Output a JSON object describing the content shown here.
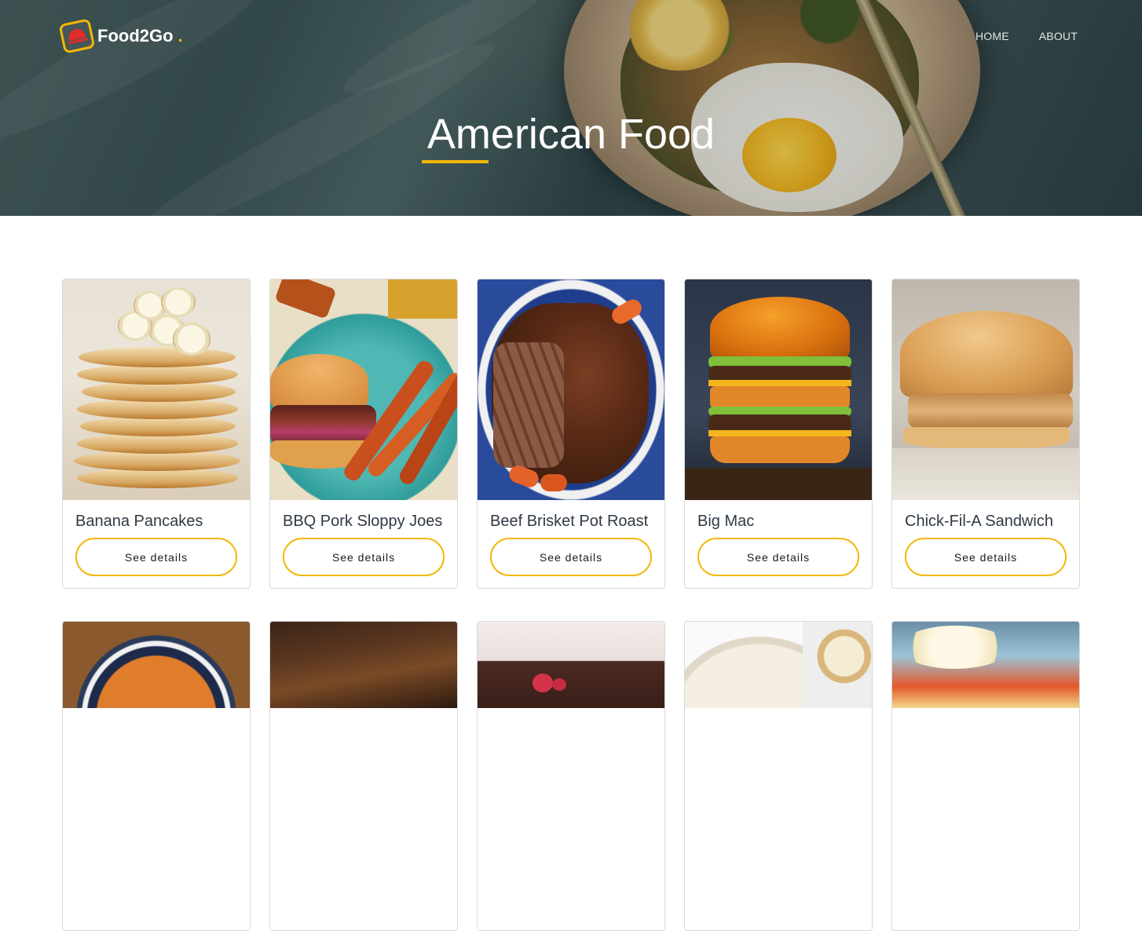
{
  "brand": {
    "name": "Food2Go",
    "dot": "."
  },
  "nav": {
    "items": [
      "HOME",
      "ABOUT"
    ]
  },
  "hero": {
    "title": "American Food",
    "accent": "#f2b705"
  },
  "cards": [
    {
      "name": "Banana Pancakes",
      "button": "See details"
    },
    {
      "name": "BBQ Pork Sloppy Joes",
      "button": "See details"
    },
    {
      "name": "Beef Brisket Pot Roast",
      "button": "See details"
    },
    {
      "name": "Big Mac",
      "button": "See details"
    },
    {
      "name": "Chick-Fil-A Sandwich",
      "button": "See details"
    }
  ],
  "colors": {
    "accent": "#f2b705",
    "text": "#2f3a45",
    "border": "#d9d9d9"
  }
}
